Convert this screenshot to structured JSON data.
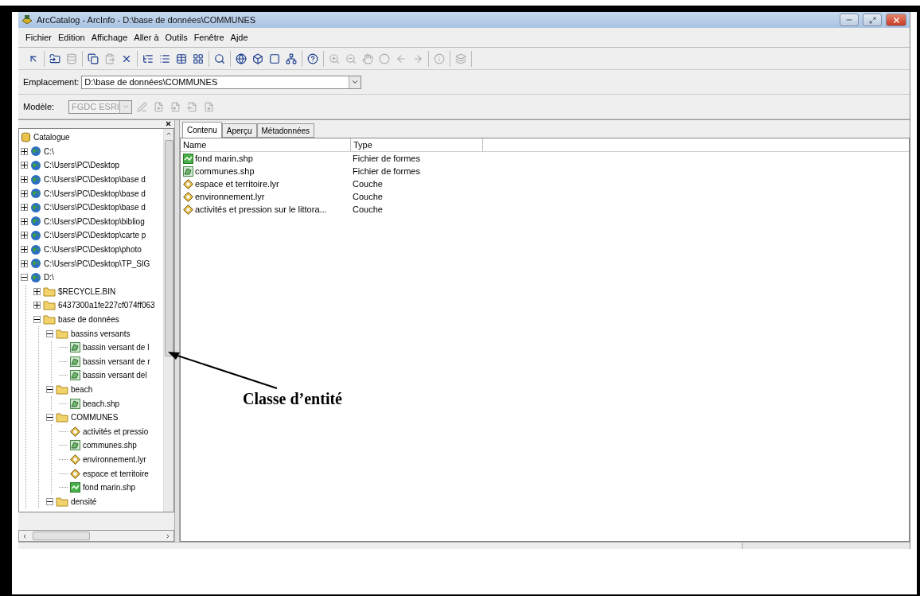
{
  "window": {
    "title": "ArcCatalog - ArcInfo - D:\\base de données\\COMMUNES"
  },
  "menu": [
    "Fichier",
    "Edition",
    "Affichage",
    "Aller à",
    "Outils",
    "Fenêtre",
    "Ajde"
  ],
  "toolbar_buttons": [
    {
      "disabled": false
    },
    {
      "disabled": false
    },
    {
      "disabled": true
    },
    {
      "disabled": false
    },
    {
      "disabled": true
    },
    {
      "disabled": false
    },
    {
      "disabled": false
    },
    {
      "disabled": false
    },
    {
      "disabled": false
    },
    {
      "disabled": false
    },
    {
      "disabled": false
    },
    {
      "disabled": false
    },
    {
      "disabled": false
    },
    {
      "disabled": false
    },
    {
      "disabled": false
    },
    {
      "disabled": false
    },
    {
      "disabled": true
    },
    {
      "disabled": true
    },
    {
      "disabled": true
    },
    {
      "disabled": true
    },
    {
      "disabled": true
    },
    {
      "disabled": true
    },
    {
      "disabled": true
    },
    {
      "disabled": true
    }
  ],
  "location": {
    "label": "Emplacement:",
    "value": "D:\\base de données\\COMMUNES"
  },
  "model": {
    "label": "Modèle:",
    "value": "FGDC ESRI",
    "disabled": true
  },
  "tree": {
    "label": "Catalogue",
    "children": [
      {
        "label": "C:\\",
        "kind": "drive",
        "expanded": false
      },
      {
        "label": "C:\\Users\\PC\\Desktop",
        "kind": "drive",
        "expanded": false
      },
      {
        "label": "C:\\Users\\PC\\Desktop\\base d",
        "kind": "drive",
        "expanded": false
      },
      {
        "label": "C:\\Users\\PC\\Desktop\\base d",
        "kind": "drive",
        "expanded": false
      },
      {
        "label": "C:\\Users\\PC\\Desktop\\base d",
        "kind": "drive",
        "expanded": false
      },
      {
        "label": "C:\\Users\\PC\\Desktop\\bibliog",
        "kind": "drive",
        "expanded": false
      },
      {
        "label": "C:\\Users\\PC\\Desktop\\carte p",
        "kind": "drive",
        "expanded": false
      },
      {
        "label": "C:\\Users\\PC\\Desktop\\photo",
        "kind": "drive",
        "expanded": false
      },
      {
        "label": "C:\\Users\\PC\\Desktop\\TP_SIG",
        "kind": "drive",
        "expanded": false
      },
      {
        "label": "D:\\",
        "kind": "drive",
        "expanded": true,
        "children": [
          {
            "label": "$RECYCLE.BIN",
            "kind": "folder",
            "expanded": false
          },
          {
            "label": "6437300a1fe227cf074ff063",
            "kind": "folder",
            "expanded": false
          },
          {
            "label": "base de données",
            "kind": "folder",
            "expanded": true,
            "children": [
              {
                "label": "bassins versants",
                "kind": "folder",
                "expanded": true,
                "children": [
                  {
                    "label": "bassin versant de l",
                    "kind": "polygon"
                  },
                  {
                    "label": "bassin versant de r",
                    "kind": "polygon"
                  },
                  {
                    "label": "bassin versant del",
                    "kind": "polygon"
                  }
                ]
              },
              {
                "label": "beach",
                "kind": "folder",
                "expanded": true,
                "children": [
                  {
                    "label": "beach.shp",
                    "kind": "polygon"
                  }
                ]
              },
              {
                "label": "COMMUNES",
                "kind": "folder",
                "expanded": true,
                "children": [
                  {
                    "label": "activités et pressio",
                    "kind": "layer"
                  },
                  {
                    "label": "communes.shp",
                    "kind": "polygon"
                  },
                  {
                    "label": "environnement.lyr",
                    "kind": "layer"
                  },
                  {
                    "label": "espace et territoire",
                    "kind": "layer"
                  },
                  {
                    "label": "fond marin.shp",
                    "kind": "line"
                  }
                ]
              },
              {
                "label": "densité",
                "kind": "folder",
                "expanded": true
              }
            ]
          }
        ]
      }
    ]
  },
  "tabs": [
    {
      "label": "Contenu",
      "selected": true
    },
    {
      "label": "Aperçu",
      "selected": false
    },
    {
      "label": "Métadonnées",
      "selected": false
    }
  ],
  "table": {
    "columns": [
      "Name",
      "Type"
    ],
    "rows": [
      {
        "name": "fond marin.shp",
        "type": "Fichier de formes",
        "kind": "line"
      },
      {
        "name": "communes.shp",
        "type": "Fichier de formes",
        "kind": "polygon"
      },
      {
        "name": "espace et territoire.lyr",
        "type": "Couche",
        "kind": "layer"
      },
      {
        "name": "environnement.lyr",
        "type": "Couche",
        "kind": "layer"
      },
      {
        "name": "activités et pression sur le littora...",
        "type": "Couche",
        "kind": "layer"
      }
    ]
  },
  "annotation": {
    "label": "Classe d’entité"
  }
}
